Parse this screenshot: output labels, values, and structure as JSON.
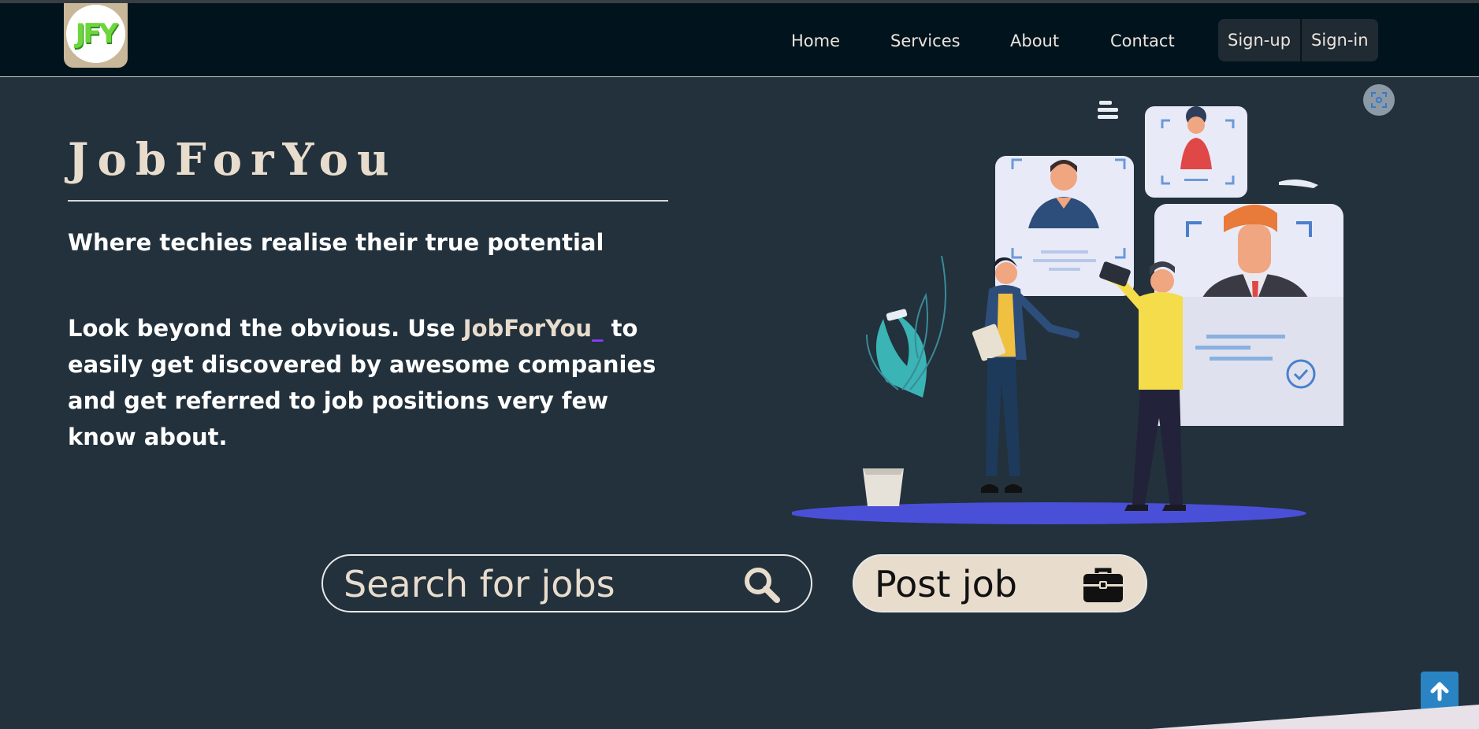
{
  "navbar": {
    "logo_text": "JFY",
    "links": [
      "Home",
      "Services",
      "About",
      "Contact"
    ],
    "signup_label": "Sign-up",
    "signin_label": "Sign-in"
  },
  "hero": {
    "title": "JobForYou",
    "tagline": "Where techies realise their true potential",
    "desc_before": "Look beyond the obvious. Use ",
    "desc_brand": "JobForYou",
    "desc_cursor": "_",
    "desc_after": " to easily get discovered by awesome companies and get referred to job positions very few know about."
  },
  "search": {
    "placeholder": "Search for jobs"
  },
  "post_job": {
    "label": "Post job"
  },
  "icons": {
    "search": "search-icon",
    "post": "briefcase-icon",
    "scroll_top": "arrow-up-icon",
    "scan": "scan-icon"
  },
  "colors": {
    "nav_bg": "#01141e",
    "page_bg": "#22313b",
    "accent_cream": "#e8dccd",
    "cursor_purple": "#8a3dff",
    "scroll_top_blue": "#2a84c4"
  }
}
